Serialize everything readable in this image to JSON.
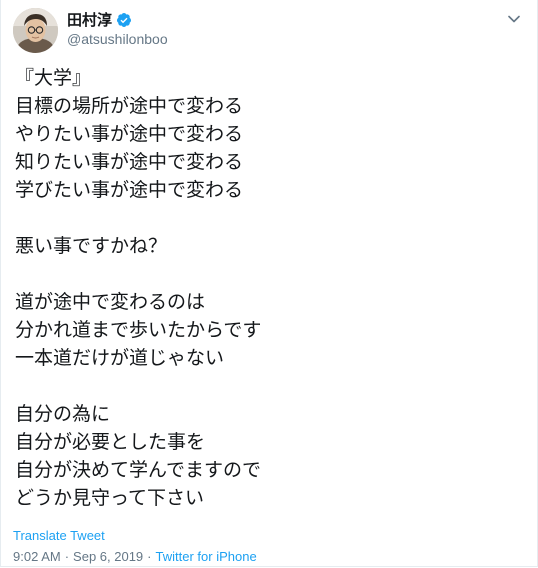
{
  "author": {
    "name": "田村淳",
    "handle": "@atsushilonboo",
    "verified": true
  },
  "tweet": {
    "lines": [
      "『大学』",
      "目標の場所が途中で変わる",
      "やりたい事が途中で変わる",
      "知りたい事が途中で変わる",
      "学びたい事が途中で変わる",
      "",
      "悪い事ですかね？",
      "",
      "道が途中で変わるのは",
      "分かれ道まで歩いたからです",
      "一本道だけが道じゃない",
      "",
      "自分の為に",
      "自分が必要とした事を",
      "自分が決めて学んでますので",
      "どうか見守って下さい"
    ]
  },
  "actions": {
    "translate_label": "Translate Tweet"
  },
  "meta": {
    "time": "9:02 AM",
    "separator": "·",
    "date": "Sep 6, 2019",
    "source": "Twitter for iPhone"
  },
  "icons": {
    "verified": "verified-badge-icon",
    "caret": "chevron-down-icon"
  },
  "colors": {
    "link": "#1da1f2",
    "muted": "#657786",
    "text": "#14171a"
  }
}
